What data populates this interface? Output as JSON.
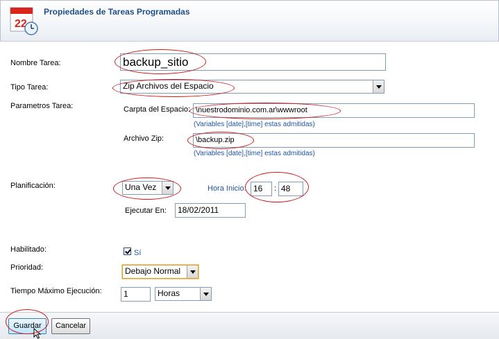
{
  "header": {
    "title": "Propiedades de Tareas Programadas",
    "icon": "calendar-clock-icon"
  },
  "form": {
    "nombre_label": "Nombre Tarea:",
    "nombre_value": "backup_sitio",
    "tipo_label": "Tipo Tarea:",
    "tipo_value": "Zip Archivos del Espacio",
    "parametros_label": "Parametros Tarea:",
    "carpeta_label": "Carpta del Espacio:",
    "carpeta_value": "\\nuestrodominio.com.ar\\wwwroot",
    "carpeta_hint": "(Variables [date],[time] estas admitidas)",
    "archivo_label": "Archivo Zip:",
    "archivo_value": "\\backup.zip",
    "archivo_hint": "(Variables [date],[time] estas admitidas)",
    "planificacion_label": "Planificación:",
    "planificacion_value": "Una Vez",
    "hora_label": "Hora Inicio:",
    "hora_h": "16",
    "hora_sep": ":",
    "hora_m": "48",
    "ejecutar_label": "Ejecutar En:",
    "ejecutar_value": "18/02/2011",
    "habilitado_label": "Habilitado:",
    "habilitado_checked": true,
    "habilitado_text": "Sí",
    "prioridad_label": "Prioridad:",
    "prioridad_value": "Debajo Normal",
    "tiempo_label": "Tiempo Máximo Ejecución:",
    "tiempo_value": "1",
    "tiempo_unit": "Horas"
  },
  "footer": {
    "save_label": "Guardar",
    "cancel_label": "Cancelar"
  },
  "colors": {
    "title": "#1e4e8c",
    "hint": "#1f55a0",
    "annotation": "#cc1a1a"
  }
}
